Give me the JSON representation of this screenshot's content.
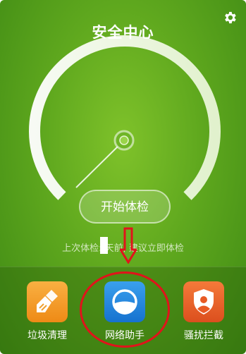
{
  "header": {
    "title": "安全中心",
    "settings_icon": "gear-icon"
  },
  "gauge": {
    "level": 0.12
  },
  "main": {
    "check_button_label": "开始体检",
    "last_check_text": "上次体检: 天前, 建议立即体检"
  },
  "tools": [
    {
      "label": "垃圾清理",
      "icon": "broom-icon",
      "color": "#f39a1e"
    },
    {
      "label": "网络助手",
      "icon": "network-assistant-icon",
      "color": "#1e7fdc"
    },
    {
      "label": "骚扰拦截",
      "icon": "shield-person-icon",
      "color": "#e85a24"
    }
  ],
  "annotation": {
    "color": "#e1131b"
  }
}
